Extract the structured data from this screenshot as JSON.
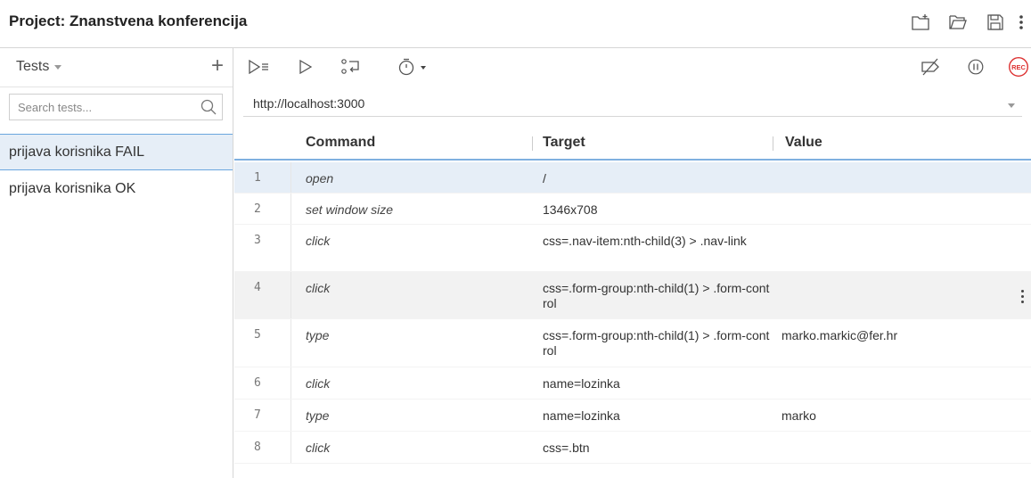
{
  "header": {
    "project_label": "Project:",
    "project_name": "Znanstvena konferencija",
    "icons": [
      "new-folder-icon",
      "open-folder-icon",
      "save-icon",
      "more-vertical-icon"
    ]
  },
  "sidebar": {
    "dropdown_label": "Tests",
    "add_symbol": "+",
    "search_placeholder": "Search tests...",
    "tests": [
      {
        "name": "prijava korisnika FAIL",
        "active": true
      },
      {
        "name": "prijava korisnika OK",
        "active": false
      }
    ]
  },
  "toolbar": {
    "icons": [
      "run-all-icon",
      "run-icon",
      "step-icon",
      "speed-icon",
      "disable-breakpoints-icon",
      "pause-icon",
      "record-icon"
    ],
    "rec_label": "REC"
  },
  "url": {
    "value": "http://localhost:3000"
  },
  "table": {
    "headers": {
      "command": "Command",
      "target": "Target",
      "value": "Value"
    },
    "rows": [
      {
        "num": "1",
        "command": "open",
        "target": "/",
        "value": ""
      },
      {
        "num": "2",
        "command": "set window size",
        "target": "1346x708",
        "value": ""
      },
      {
        "num": "3",
        "command": "click",
        "target": "css=.nav-item:nth-child(3) > .nav-link",
        "value": ""
      },
      {
        "num": "4",
        "command": "click",
        "target": "css=.form-group:nth-child(1) > .form-control",
        "value": ""
      },
      {
        "num": "5",
        "command": "type",
        "target": "css=.form-group:nth-child(1) > .form-control",
        "value": "marko.markic@fer.hr"
      },
      {
        "num": "6",
        "command": "click",
        "target": "name=lozinka",
        "value": ""
      },
      {
        "num": "7",
        "command": "type",
        "target": "name=lozinka",
        "value": "marko"
      },
      {
        "num": "8",
        "command": "click",
        "target": "css=.btn",
        "value": ""
      }
    ]
  },
  "colors": {
    "selected_row": "#e6eef7",
    "accent_blue": "#7fb0e0",
    "record_red": "#d33"
  }
}
